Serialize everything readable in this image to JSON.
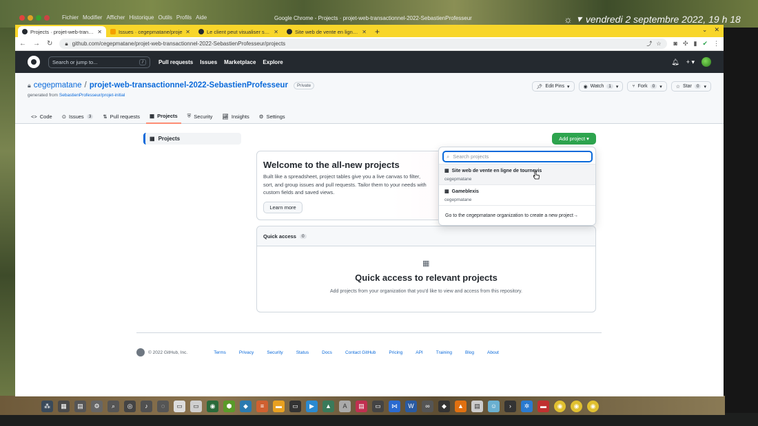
{
  "os": {
    "menu": [
      "Fichier",
      "Modifier",
      "Afficher",
      "Historique",
      "Outils",
      "Profils",
      "Aide"
    ],
    "window_title": "Google Chrome - Projects · projet-web-transactionnel-2022-SebastienProfesseur",
    "clock": "vendredi 2 septembre 2022, 19 h 18"
  },
  "browser": {
    "tabs": [
      {
        "title": "Projects · projet-web-transac",
        "active": true
      },
      {
        "title": "Issues · cegepmatane/proje",
        "active": false
      },
      {
        "title": "Le client peut visualiser som",
        "active": false
      },
      {
        "title": "Site web de vente en ligne de",
        "active": false
      }
    ],
    "url": "github.com/cegepmatane/projet-web-transactionnel-2022-SebastienProfesseur/projects"
  },
  "gh": {
    "search_placeholder": "Search or jump to...",
    "search_key": "/",
    "nav": [
      "Pull requests",
      "Issues",
      "Marketplace",
      "Explore"
    ]
  },
  "repo": {
    "owner": "cegepmatane",
    "name": "projet-web-transactionnel-2022-SebastienProfesseur",
    "visibility": "Private",
    "generated_prefix": "generated from",
    "generated_link": "SebastienProfesseur/projet-initial",
    "actions": {
      "edit_pins": "Edit Pins",
      "watch": "Watch",
      "watch_count": "1",
      "fork": "Fork",
      "fork_count": "0",
      "star": "Star",
      "star_count": "0"
    },
    "tabs": [
      {
        "label": "Code"
      },
      {
        "label": "Issues",
        "count": "3"
      },
      {
        "label": "Pull requests"
      },
      {
        "label": "Projects"
      },
      {
        "label": "Security"
      },
      {
        "label": "Insights"
      },
      {
        "label": "Settings"
      }
    ]
  },
  "sidebar": {
    "projects_label": "Projects"
  },
  "add_project": "Add project",
  "welcome": {
    "title": "Welcome to the all-new projects",
    "body": "Built like a spreadsheet, project tables give you a live canvas to filter, sort, and group issues and pull requests. Tailor them to your needs with custom fields and saved views.",
    "learn_more": "Learn more"
  },
  "quick_access": {
    "header": "Quick access",
    "count": "0",
    "title": "Quick access to relevant projects",
    "body": "Add projects from your organization that you'd like to view and access from this repository."
  },
  "dropdown": {
    "placeholder": "Search projects",
    "items": [
      {
        "name": "Site web de vente en ligne de tournevis",
        "owner": "cegepmatane"
      },
      {
        "name": "Gameblexis",
        "owner": "cegepmatane"
      }
    ],
    "footer": "Go to the cegepmatane organization to create a new project"
  },
  "footer": {
    "copyright": "© 2022 GitHub, Inc.",
    "links": [
      "Terms",
      "Privacy",
      "Security",
      "Status",
      "Docs",
      "Contact GitHub",
      "Pricing",
      "API",
      "Training",
      "Blog",
      "About"
    ]
  }
}
